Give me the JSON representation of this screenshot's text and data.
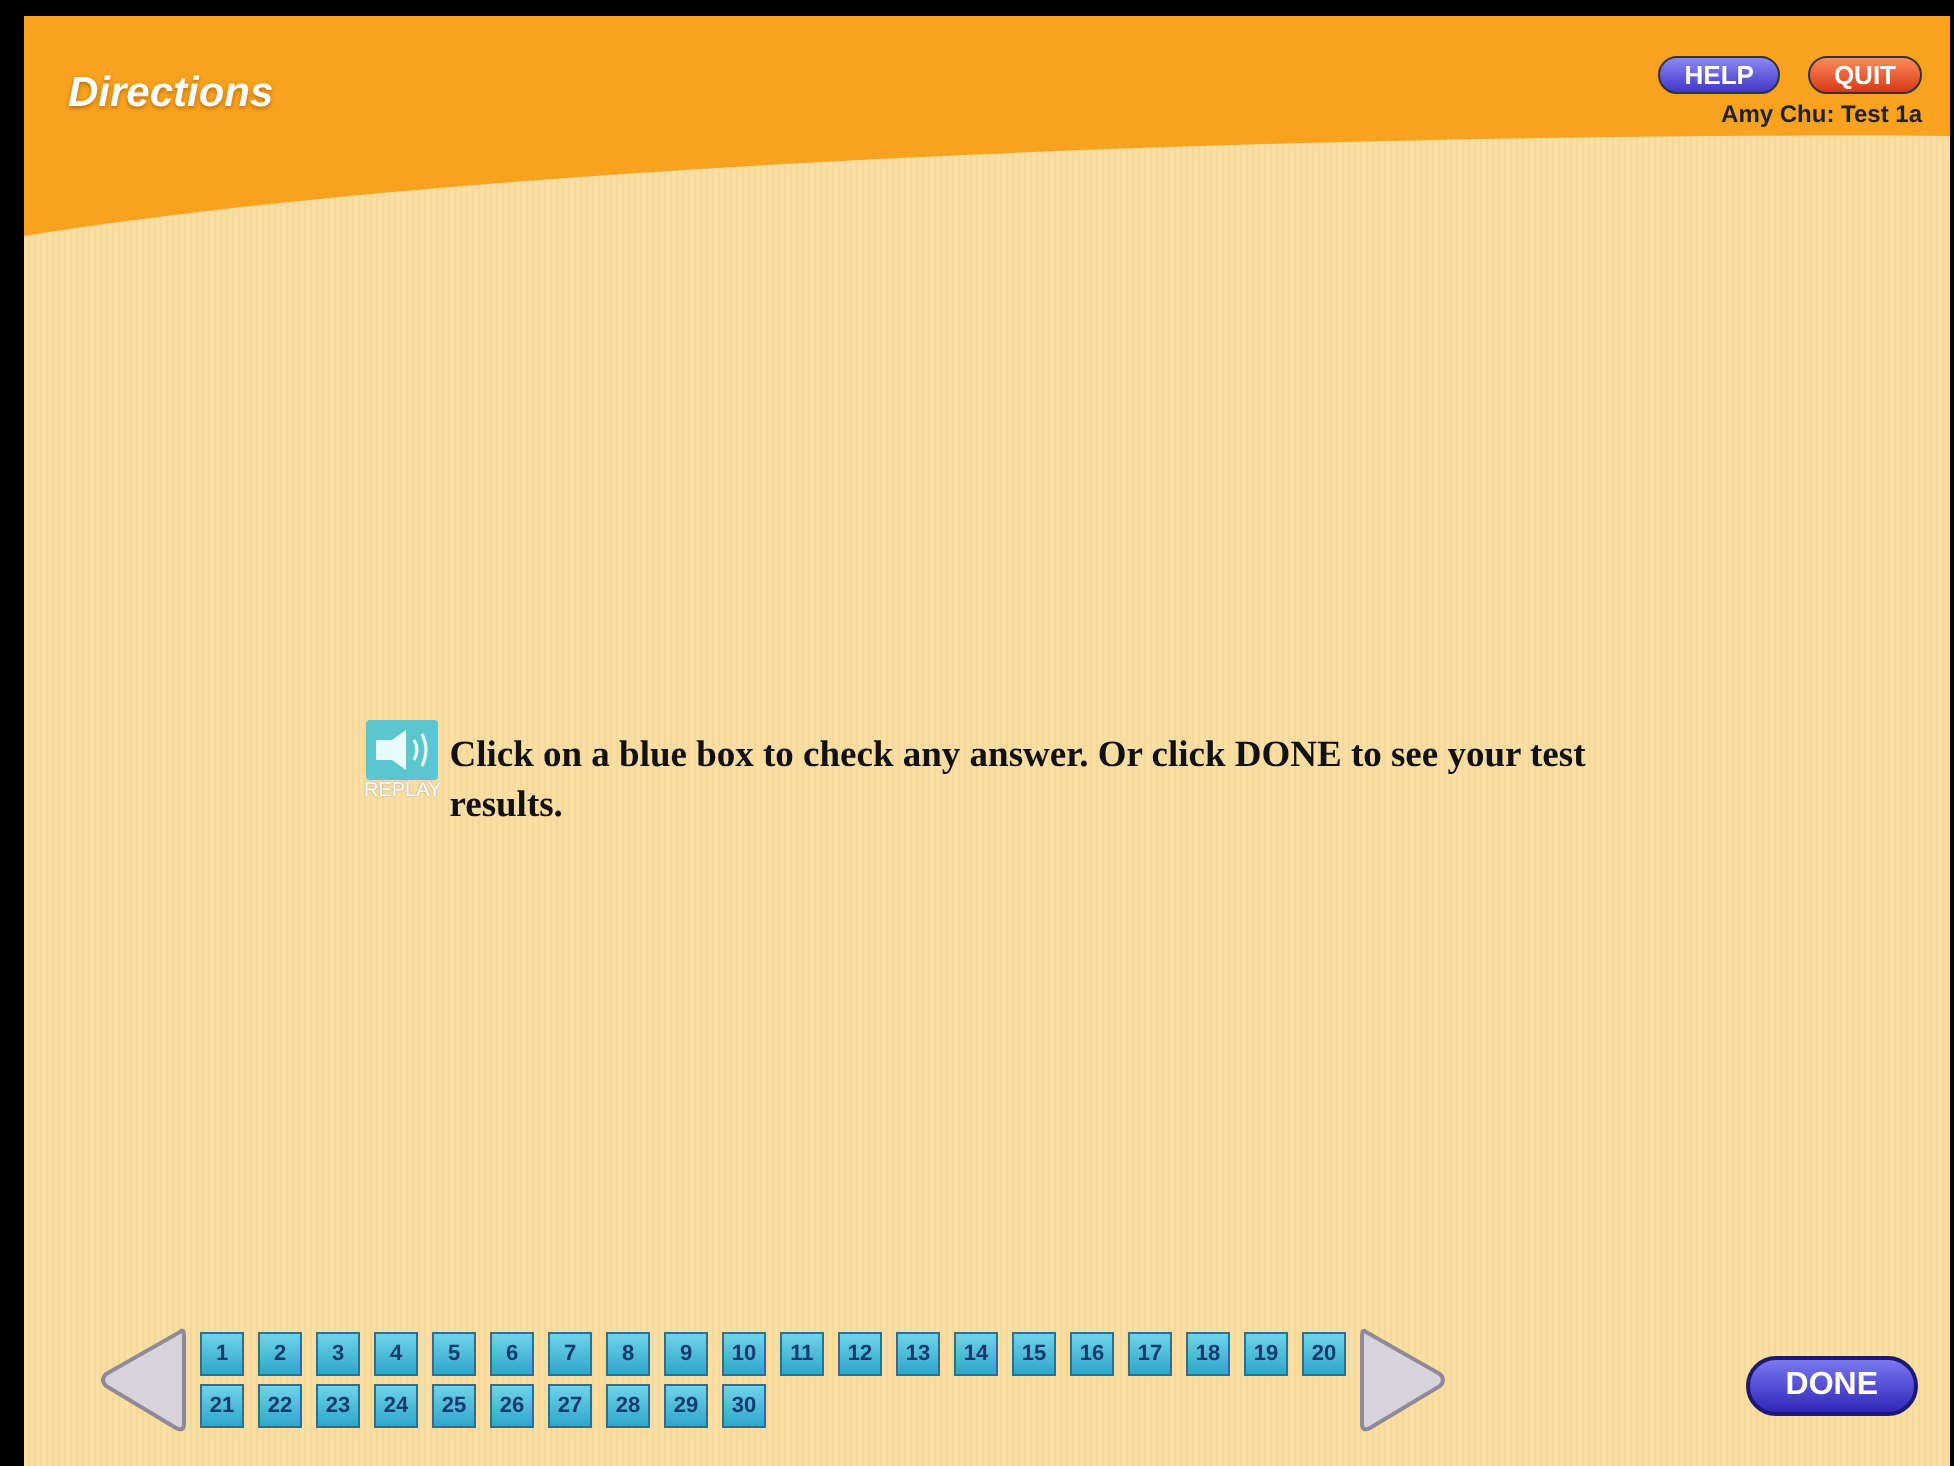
{
  "header": {
    "title": "Directions",
    "buttons": [
      {
        "label": "HELP",
        "kind": "help"
      },
      {
        "label": "QUIT",
        "kind": "quit"
      }
    ],
    "user": "Amy Chu: Test 1a"
  },
  "instruction": {
    "replay_label": "REPLAY",
    "text": "Click on a blue box to check any answer. Or click DONE to see your test results."
  },
  "questions": [
    "1",
    "2",
    "3",
    "4",
    "5",
    "6",
    "7",
    "8",
    "9",
    "10",
    "11",
    "12",
    "13",
    "14",
    "15",
    "16",
    "17",
    "18",
    "19",
    "20",
    "21",
    "22",
    "23",
    "24",
    "25",
    "26",
    "27",
    "28",
    "29",
    "30"
  ],
  "done_button": "DONE"
}
